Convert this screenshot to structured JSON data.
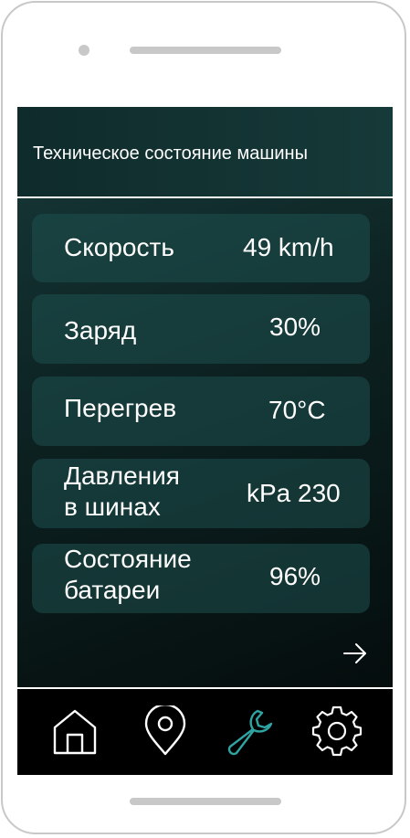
{
  "header": {
    "title": "Техническое состояние машины"
  },
  "metrics": [
    {
      "label": "Скорость",
      "value": "49 km/h"
    },
    {
      "label": "Заряд",
      "value": "30%"
    },
    {
      "label": "Перегрев",
      "value": "70°C"
    },
    {
      "label": "Давления\nв шинах",
      "value": "kPa 230"
    },
    {
      "label": "Состояние\nбатареи",
      "value": "96%"
    }
  ],
  "nav": {
    "items": [
      {
        "icon": "home-icon",
        "active": false
      },
      {
        "icon": "location-pin-icon",
        "active": false
      },
      {
        "icon": "wrench-icon",
        "active": true
      },
      {
        "icon": "gear-icon",
        "active": false
      }
    ]
  },
  "colors": {
    "accent": "#2fa5a3",
    "icon": "#ffffff",
    "card": "#1e504e",
    "header_bg": "#12302f"
  },
  "icons": {
    "next": "arrow-right-icon"
  }
}
